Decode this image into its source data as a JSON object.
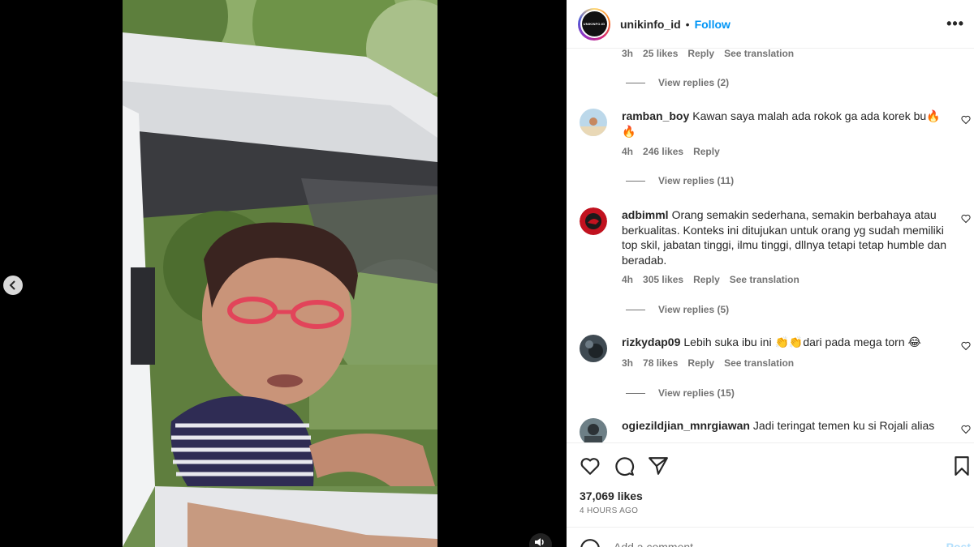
{
  "colors": {
    "accent": "#0095f6",
    "muted": "#737373",
    "text": "#262626",
    "divider": "#efefef"
  },
  "post": {
    "username": "unikinfo_id",
    "separator": "•",
    "follow_label": "Follow",
    "more_icon": "more-horizontal-icon",
    "avatar_text": "UNIKINFO.ID"
  },
  "comments": {
    "top_meta": {
      "time": "3h",
      "likes": "25 likes",
      "reply": "Reply",
      "translation": "See translation"
    },
    "top_view_replies": "View replies (2)",
    "items": [
      {
        "user": "ramban_boy",
        "text": "Kawan saya malah ada rokok ga ada korek bu🔥🔥",
        "time": "4h",
        "likes": "246 likes",
        "reply": "Reply",
        "translation": "",
        "view_replies": "View replies (11)"
      },
      {
        "user": "adbimml",
        "text": "Orang semakin sederhana, semakin berbahaya atau berkualitas. Konteks ini ditujukan untuk orang yg sudah memiliki top skil, jabatan tinggi, ilmu tinggi, dllnya tetapi tetap humble dan beradab.",
        "time": "4h",
        "likes": "305 likes",
        "reply": "Reply",
        "translation": "See translation",
        "view_replies": "View replies (5)"
      },
      {
        "user": "rizkydap09",
        "text": "Lebih suka ibu ini 👏👏dari pada mega torn 😂",
        "time": "3h",
        "likes": "78 likes",
        "reply": "Reply",
        "translation": "See translation",
        "view_replies": "View replies (15)"
      },
      {
        "user": "ogiezildjian_mnrgiawan",
        "text": "Jadi teringat temen ku si Rojali alias",
        "time": "",
        "likes": "",
        "reply": "",
        "translation": "",
        "view_replies": ""
      }
    ]
  },
  "actions": {
    "like_icon": "heart-icon",
    "comment_icon": "comment-bubble-icon",
    "share_icon": "send-paper-plane-icon",
    "save_icon": "bookmark-icon",
    "likes_count": "37,069 likes",
    "time_ago": "4 HOURS AGO"
  },
  "add_comment": {
    "placeholder": "Add a comment...",
    "post_label": "Post"
  },
  "media": {
    "prev_icon": "chevron-left-icon",
    "mute_icon": "volume-icon"
  }
}
